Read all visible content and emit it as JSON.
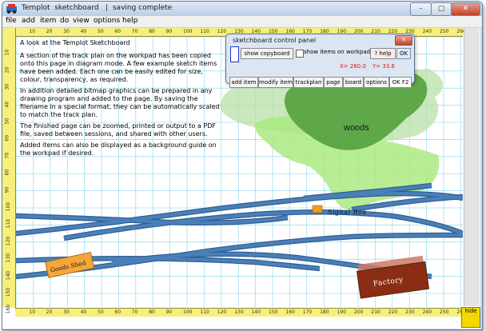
{
  "window": {
    "title": "Templot  sketchboard   |  saving complete",
    "buttons": {
      "minimize": "–",
      "maximize": "▢",
      "close": "✕"
    }
  },
  "menu": [
    "file",
    "add",
    "item",
    "do",
    "view",
    "options",
    "help"
  ],
  "ruler": {
    "top": [
      "10",
      "20",
      "30",
      "40",
      "50",
      "60",
      "70",
      "80",
      "90",
      "100",
      "110",
      "120",
      "130",
      "140",
      "150",
      "160",
      "170",
      "180",
      "190",
      "200",
      "210",
      "220",
      "230",
      "240",
      "250",
      "260"
    ],
    "bottom": [
      "10",
      "20",
      "30",
      "40",
      "50",
      "60",
      "70",
      "80",
      "90",
      "100",
      "110",
      "120",
      "130",
      "140",
      "150",
      "160",
      "170",
      "180",
      "190",
      "200",
      "210",
      "220",
      "230",
      "240",
      "250",
      "260"
    ],
    "left": [
      "10",
      "20",
      "30",
      "40",
      "50",
      "60",
      "70",
      "80",
      "90",
      "100",
      "110",
      "120",
      "130",
      "140",
      "150",
      "160"
    ]
  },
  "notes": {
    "heading": "A look at the Templot Sketchboard",
    "paragraphs": [
      "A section of the track plan on the workpad has been copied onto this page in diagram mode. A few example sketch items have been added. Each one can be easily edited for size, colour, transparency, as required.",
      "In addition detailed bitmap graphics can be prepared in any drawing program and added to the page. By saving the filename in a special format, they can be automatically scaled to match the track plan.",
      "The finished page can be zoomed, printed or output to a PDF file, saved between sessions, and shared with other users.",
      "Added items can also be displayed as a background guide on the workpad if desired."
    ]
  },
  "labels": {
    "woods": "woods",
    "signal_box": "Signal Box",
    "goods_shed": "Goods Shed",
    "factory": "Factory"
  },
  "panel": {
    "title": "sketchboard  control  panel",
    "show_copyboard": "show copyboard",
    "show_items": "show items on workpad",
    "show_items_checked": false,
    "help": "? help",
    "ok": "OK",
    "x": "X= 260.0",
    "y": "Y= 33.6",
    "tabs": [
      "add item",
      "modify item",
      "trackplan",
      "page",
      "board",
      "options",
      "OK F2"
    ]
  },
  "hide_label": "hide",
  "colors": {
    "track": "#4a7fb8",
    "ruler": "#f6ef7a",
    "grid": "#7fd6ee",
    "woods_light": "#b9dfa8",
    "woods_mid": "#a8e87a",
    "woods_dark": "#5fa84a",
    "goods_shed": "#f4a63c",
    "factory": "#8b2d14",
    "signal_box": "#f39a1a"
  }
}
